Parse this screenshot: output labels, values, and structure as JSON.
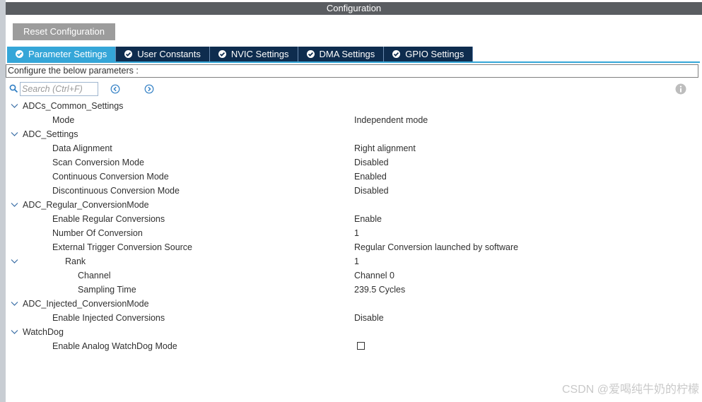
{
  "window": {
    "title": "Configuration"
  },
  "reset_button": "Reset Configuration",
  "tabs": [
    {
      "label": "Parameter Settings",
      "active": true
    },
    {
      "label": "User Constants",
      "active": false
    },
    {
      "label": "NVIC Settings",
      "active": false
    },
    {
      "label": "DMA Settings",
      "active": false
    },
    {
      "label": "GPIO Settings",
      "active": false
    }
  ],
  "instruction": "Configure the below parameters :",
  "search": {
    "placeholder": "Search (Ctrl+F)"
  },
  "colors": {
    "active_tab": "#35a6d8",
    "inactive_tab": "#0e2c4e",
    "titlebar": "#5a5d61",
    "caret": "#3a6ea5"
  },
  "tree": {
    "adcs_common": {
      "label": "ADCs_Common_Settings",
      "mode": {
        "label": "Mode",
        "value": "Independent mode"
      }
    },
    "adc_settings": {
      "label": "ADC_Settings",
      "data_alignment": {
        "label": "Data Alignment",
        "value": "Right alignment"
      },
      "scan_mode": {
        "label": "Scan Conversion Mode",
        "value": "Disabled"
      },
      "continuous_mode": {
        "label": "Continuous Conversion Mode",
        "value": "Enabled"
      },
      "discontinuous_mode": {
        "label": "Discontinuous Conversion Mode",
        "value": "Disabled"
      }
    },
    "adc_regular": {
      "label": "ADC_Regular_ConversionMode",
      "enable_regular": {
        "label": "Enable Regular Conversions",
        "value": "Enable"
      },
      "number_of_conversion": {
        "label": "Number Of Conversion",
        "value": "1"
      },
      "external_trigger": {
        "label": "External Trigger Conversion Source",
        "value": "Regular Conversion launched by software"
      },
      "rank": {
        "label": "Rank",
        "value": "1"
      },
      "channel": {
        "label": "Channel",
        "value": "Channel 0"
      },
      "sampling_time": {
        "label": "Sampling Time",
        "value": "239.5 Cycles"
      }
    },
    "adc_injected": {
      "label": "ADC_Injected_ConversionMode",
      "enable_injected": {
        "label": "Enable Injected Conversions",
        "value": "Disable"
      }
    },
    "watchdog": {
      "label": "WatchDog",
      "analog_watchdog": {
        "label": "Enable Analog WatchDog Mode",
        "checked": false
      }
    }
  },
  "watermark": "CSDN @爱喝纯牛奶的柠檬"
}
